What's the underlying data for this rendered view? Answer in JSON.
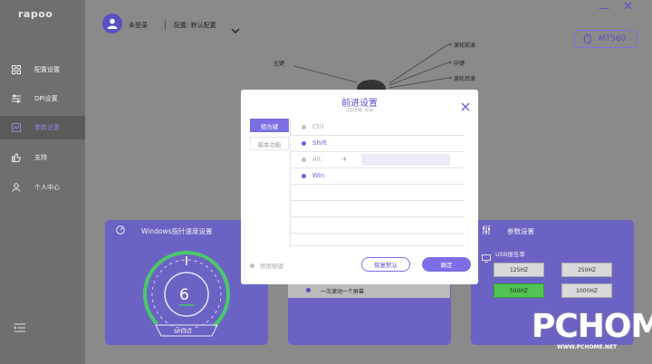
{
  "app": {
    "logo": "rapoo"
  },
  "sidebar": {
    "items": [
      {
        "label": "配置设置",
        "icon": "grid-icon"
      },
      {
        "label": "DPI设置",
        "icon": "sliders-icon"
      },
      {
        "label": "参数设置",
        "icon": "chart-icon",
        "active": true
      },
      {
        "label": "支持",
        "icon": "thumbs-up-icon"
      },
      {
        "label": "个人中心",
        "icon": "user-icon"
      }
    ]
  },
  "header": {
    "user_status": "未登录",
    "config_label": "配置: 默认配置",
    "device": "MT560"
  },
  "mouse_labels": {
    "left": "左键",
    "scroll_forward": "滚轮前滚",
    "middle": "中键",
    "scroll_back": "滚轮后滚"
  },
  "panels": {
    "pointer_speed": {
      "title": "Windows指针速度设置",
      "value": "6",
      "gauge_label": "SPEED"
    },
    "scroll": {
      "option": "一次滚动一个屏幕"
    },
    "params": {
      "title": "参数设置",
      "usb_label": "USB报告率",
      "rates": [
        "125HZ",
        "250HZ",
        "500HZ",
        "1000HZ"
      ],
      "selected_rate": "500HZ"
    }
  },
  "modal": {
    "title": "前进设置",
    "subtitle": "当前功能: 前进",
    "tabs": [
      "组合键",
      "基本功能"
    ],
    "keys": [
      {
        "label": "Ctrl",
        "checked": false
      },
      {
        "label": "Shift",
        "checked": true
      },
      {
        "label": "Alt",
        "checked": false
      },
      {
        "label": "Win",
        "checked": true
      }
    ],
    "plus_sign": "+",
    "disable_label": "禁用按键",
    "restore_label": "恢复默认",
    "ok_label": "确定"
  },
  "colors": {
    "accent": "#7b6fe3",
    "selected_rate": "#52c455"
  },
  "watermark": {
    "brand": "PCHOME",
    "url": "WWW.PCHOME.NET"
  }
}
